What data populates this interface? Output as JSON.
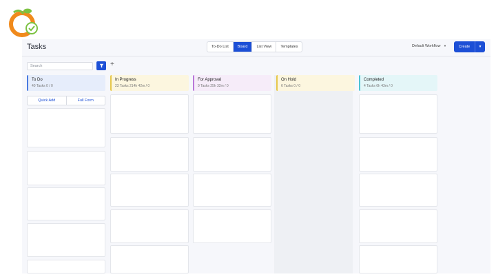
{
  "header": {
    "title": "Tasks",
    "views": [
      "To-Do List",
      "Board",
      "List View",
      "Templates"
    ],
    "active_view": "Board",
    "workflow": "Default Workflow",
    "create_label": "Create"
  },
  "toolbar": {
    "search_placeholder": "Search"
  },
  "columns": [
    {
      "name": "To Do",
      "meta": "40 Tasks  0 / 0",
      "color": "#4a7be0",
      "bg": "#e6edfb",
      "quick_add": "Quick Add",
      "full_form": "Full Form"
    },
    {
      "name": "In Progress",
      "meta": "23 Tasks  214h 42m / 0",
      "color": "#e6c74a",
      "bg": "#fcf6df"
    },
    {
      "name": "For Approval",
      "meta": "9 Tasks  25h 32m / 0",
      "color": "#b977d9",
      "bg": "#f6ecf9"
    },
    {
      "name": "On Hold",
      "meta": "6 Tasks  0 / 0",
      "color": "#e6c74a",
      "bg": "#fcf6df"
    },
    {
      "name": "Completed",
      "meta": "4 Tasks  6h 43m / 0",
      "color": "#4cc3d3",
      "bg": "#e4f6f8"
    }
  ],
  "icons": {
    "logo": "logo-icon",
    "filter": "filter-icon",
    "add": "plus-icon",
    "dropdown": "chevron-down-icon"
  },
  "colors": {
    "accent": "#1c4fd6"
  }
}
